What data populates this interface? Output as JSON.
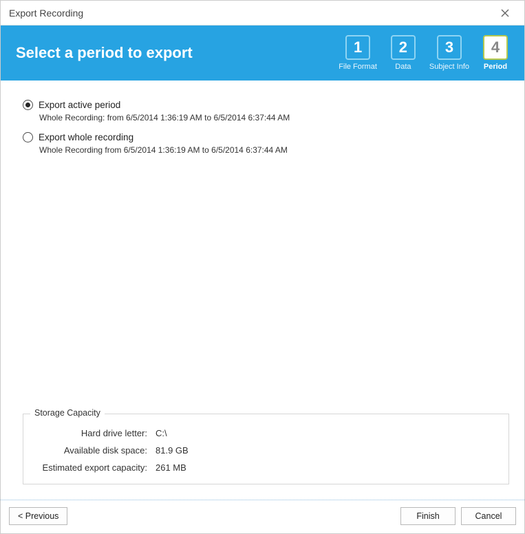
{
  "window": {
    "title": "Export Recording"
  },
  "header": {
    "title": "Select a period to export",
    "steps": [
      {
        "num": "1",
        "label": "File Format",
        "active": false
      },
      {
        "num": "2",
        "label": "Data",
        "active": false
      },
      {
        "num": "3",
        "label": "Subject Info",
        "active": false
      },
      {
        "num": "4",
        "label": "Period",
        "active": true
      }
    ]
  },
  "options": {
    "active_period": {
      "label": "Export active period",
      "desc": "Whole Recording: from 6/5/2014 1:36:19 AM to 6/5/2014 6:37:44 AM",
      "checked": true
    },
    "whole_recording": {
      "label": "Export whole recording",
      "desc": "Whole Recording from 6/5/2014 1:36:19 AM to 6/5/2014 6:37:44 AM",
      "checked": false
    }
  },
  "storage": {
    "legend": "Storage Capacity",
    "drive_label": "Hard drive letter:",
    "drive_value": "C:\\",
    "space_label": "Available disk space:",
    "space_value": "81.9 GB",
    "capacity_label": "Estimated export capacity:",
    "capacity_value": "261 MB"
  },
  "footer": {
    "previous": "< Previous",
    "finish": "Finish",
    "cancel": "Cancel"
  }
}
